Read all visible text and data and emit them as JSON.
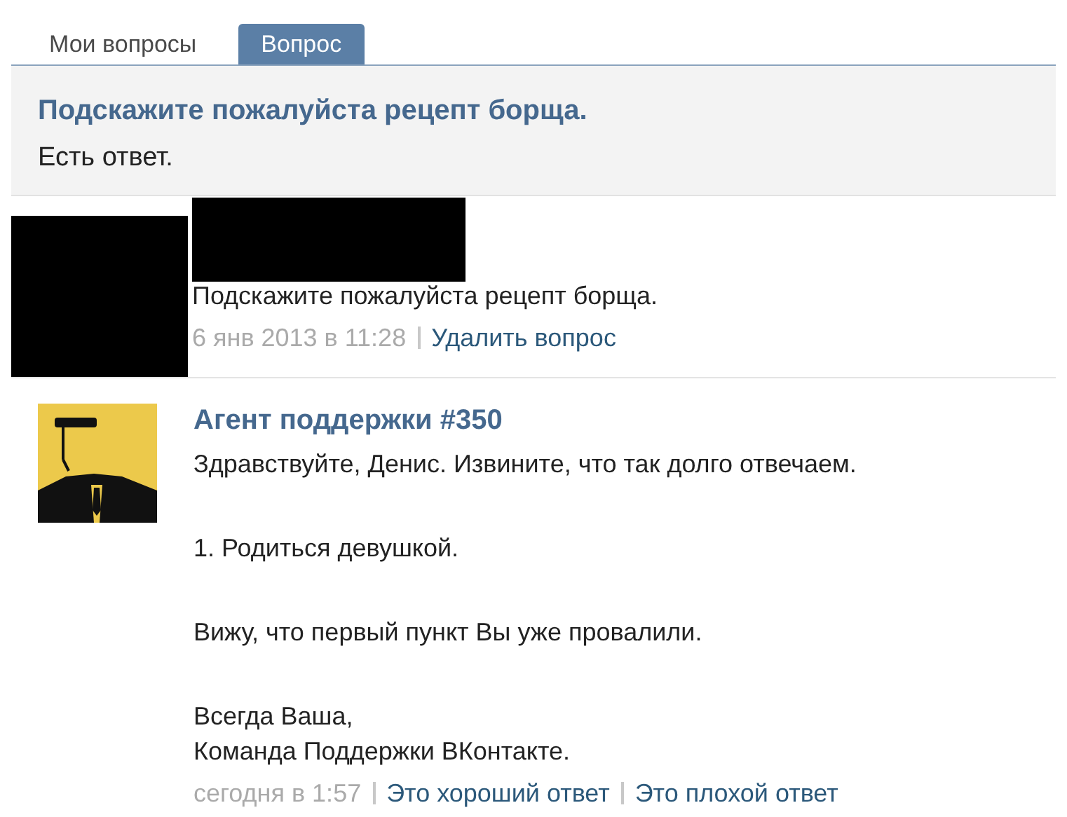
{
  "tabs": [
    {
      "label": "Мои вопросы",
      "selected": false
    },
    {
      "label": "Вопрос",
      "selected": true
    }
  ],
  "question_header": {
    "title": "Подскажите пожалуйста рецепт борща.",
    "status": "Есть ответ."
  },
  "question_post": {
    "text": "Подскажите пожалуйста рецепт борща.",
    "date": "6 янв 2013 в 11:28",
    "actions": [
      "Удалить вопрос"
    ]
  },
  "answer_post": {
    "author": "Агент поддержки #350",
    "paragraphs": [
      [
        "Здравствуйте, Денис. Извините, что так долго отвечаем."
      ],
      [
        "1. Родиться девушкой."
      ],
      [
        "Вижу, что первый пункт Вы уже провалили."
      ],
      [
        "Всегда Ваша,",
        "Команда Поддержки ВКонтакте."
      ]
    ],
    "date": "сегодня в 1:57",
    "actions": [
      "Это хороший ответ",
      "Это плохой ответ"
    ]
  }
}
